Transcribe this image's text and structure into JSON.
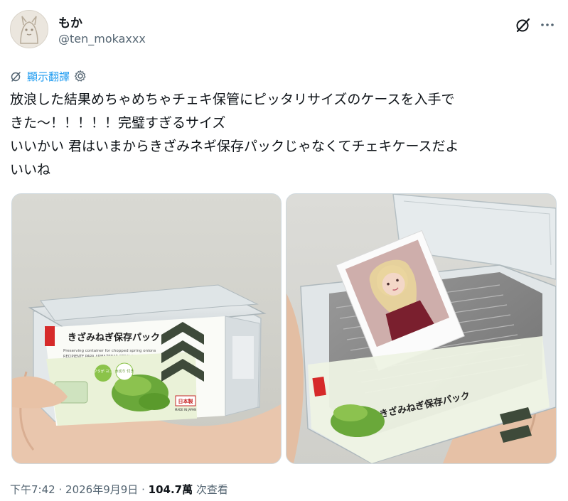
{
  "user": {
    "display_name": "もか",
    "handle": "@ten_mokaxxx"
  },
  "translate": {
    "label": "顯示翻譯"
  },
  "tweet": {
    "lines": [
      "放浪した結果めちゃめちゃチェキ保管にピッタリサイズのケースを入手で",
      "きた〜！！！！！完璧すぎるサイズ",
      "いいかい 君はいまからきざみネギ保存パックじゃなくてチェキケースだよ",
      "いいね"
    ]
  },
  "photo_left": {
    "package_title": "きざみねぎ保存パック",
    "package_subtitle": "Preserving container for chopped spring onions",
    "package_subtitle_es": "RECIPIENTE PARA ARMAZENAR CEBOLINHA PICADA",
    "badge_1": "フタが ヨコ",
    "badge_2": "水切り 付き",
    "made_in": "日本製",
    "made_in_en": "MADE IN JAPAN"
  },
  "photo_right": {
    "package_title": "きざみねぎ保存パック"
  },
  "meta": {
    "time": "下午7:42",
    "separator1": "·",
    "date": "2026年9月9日",
    "separator2": "·",
    "views_count": "104.7萬",
    "views_label": "次查看"
  },
  "colors": {
    "accent": "#1d9bf0",
    "text_secondary": "#536471",
    "text_primary": "#0f1419"
  },
  "icons": {
    "grok": "grok-slash-icon",
    "more": "more-dots-icon",
    "translate": "translate-icon",
    "settings": "gear-icon"
  }
}
